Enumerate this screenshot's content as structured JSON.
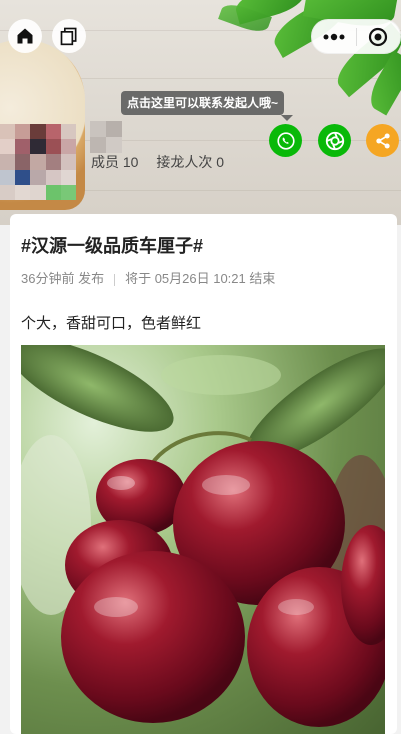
{
  "header": {
    "home_icon": "home-icon",
    "copy_icon": "copy-icon",
    "more_icon": "more-dots-icon",
    "close_icon": "target-close-icon",
    "tooltip": "点击这里可以联系发起人哦~",
    "actions": [
      {
        "icon": "phone-icon",
        "color": "#09b909"
      },
      {
        "icon": "camera-shutter-icon",
        "color": "#09b909"
      },
      {
        "icon": "share-icon",
        "color": "#f5a623"
      }
    ],
    "members_label": "成员 10",
    "jielong_label": "接龙人次 0"
  },
  "post": {
    "title": "#汉源一级品质车厘子#",
    "published": "36分钟前 发布",
    "ends": "将于 05月26日 10:21 结束",
    "description": "个大，香甜可口，色者鲜红"
  }
}
